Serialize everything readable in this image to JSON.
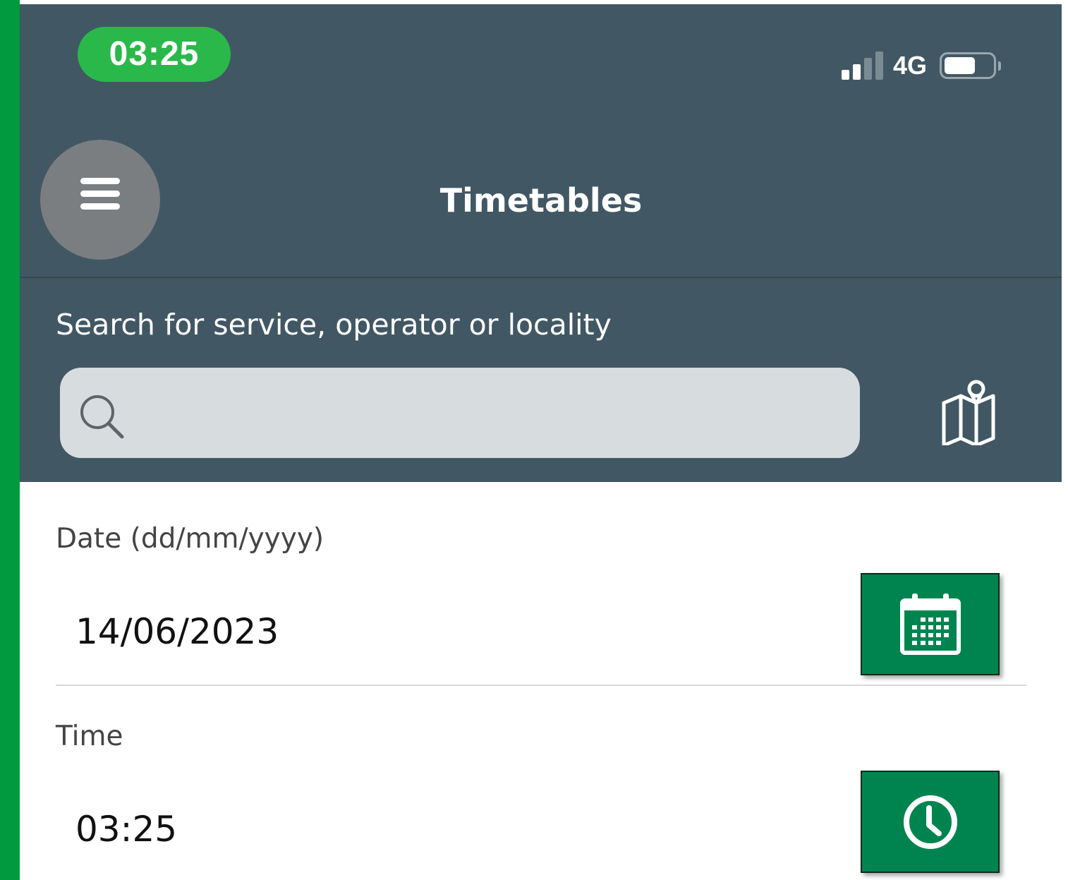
{
  "status_bar": {
    "time": "03:25",
    "network": "4G",
    "signal_bars_active": 2,
    "signal_bars_total": 4,
    "battery_level": 0.65,
    "icons": [
      "signal-icon",
      "battery-icon"
    ]
  },
  "header": {
    "title": "Timetables",
    "menu_icon": "hamburger-menu-icon"
  },
  "search": {
    "label": "Search for service, operator or locality",
    "value": "",
    "placeholder": "",
    "search_icon": "magnifier-icon",
    "map_icon": "map-pin-icon"
  },
  "date_field": {
    "label": "Date (dd/mm/yyyy)",
    "value": "14/06/2023",
    "button_icon": "calendar-icon"
  },
  "time_field": {
    "label": "Time",
    "value": "03:25",
    "button_icon": "clock-icon"
  },
  "colors": {
    "header_bg": "#415764",
    "accent_green": "#00844f",
    "edge_green": "#019a3e",
    "time_pill": "#2ab84a",
    "search_box": "#d7dcdf",
    "menu_button": "#7b7e80"
  }
}
